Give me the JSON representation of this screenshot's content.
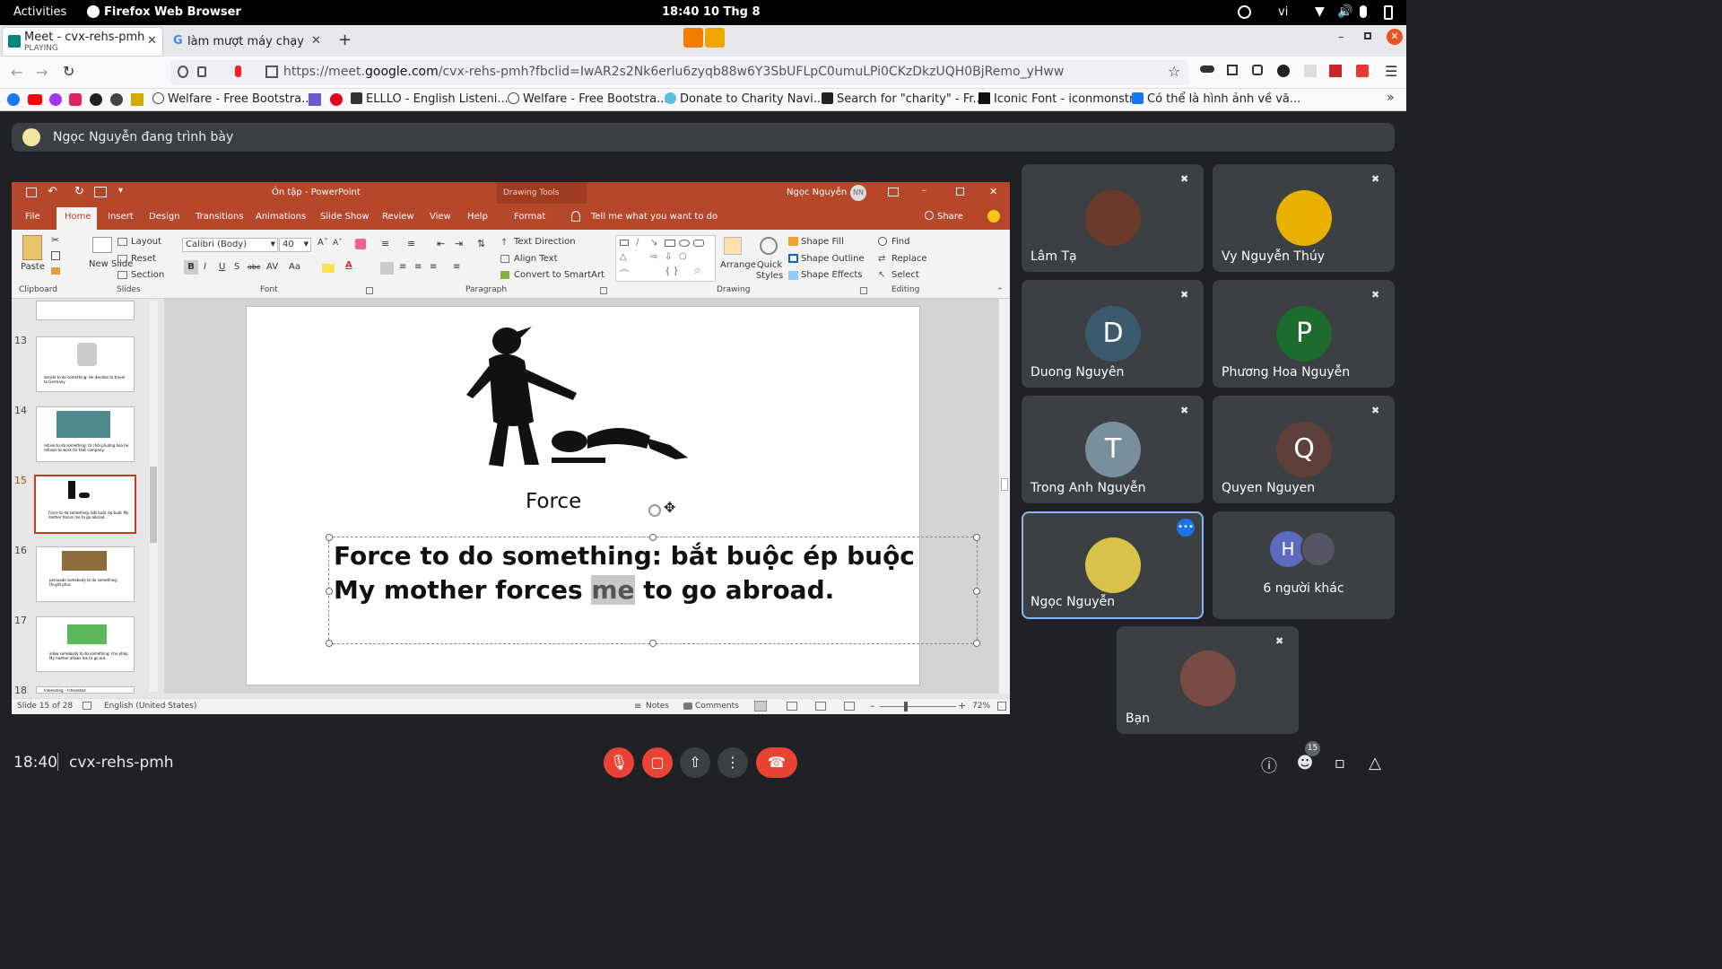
{
  "gnome": {
    "activities": "Activities",
    "app": "Firefox Web Browser",
    "clock": "18:40  10 Thg 8",
    "lang": "vi"
  },
  "tabs": [
    {
      "title": "Meet - cvx-rehs-pmh",
      "sub": "PLAYING"
    },
    {
      "title": "làm mượt máy chạy hệ"
    }
  ],
  "url": {
    "prefix": "https://meet.",
    "domain": "google.com",
    "rest": "/cvx-rehs-pmh?fbclid=IwAR2s2Nk6erlu6zyqb88w6Y3SbUFLpC0umuLPi0CKzDkzUQH0BjRemo_yHww"
  },
  "bookmarks": [
    "Welfare - Free Bootstra...",
    "ELLLO - English Listeni...",
    "Welfare - Free Bootstra...",
    "Donate to Charity Navi...",
    "Search for \"charity\" - Fr...",
    "Iconic Font - iconmonstr",
    "Có thể là hình ảnh về vă..."
  ],
  "presenting": "Ngọc Nguyễn đang trình bày",
  "ppt": {
    "title": "Ôn tập  -  PowerPoint",
    "drawing_tools": "Drawing Tools",
    "user": "Ngọc Nguyễn",
    "initials": "NN",
    "tabs": [
      "File",
      "Home",
      "Insert",
      "Design",
      "Transitions",
      "Animations",
      "Slide Show",
      "Review",
      "View",
      "Help",
      "Format"
    ],
    "tell_me": "Tell me what you want to do",
    "share": "Share",
    "groups": [
      "Clipboard",
      "Slides",
      "Font",
      "Paragraph",
      "Drawing",
      "Editing"
    ],
    "ribbon": {
      "paste": "Paste",
      "new_slide": "New Slide",
      "layout": "Layout",
      "reset": "Reset",
      "section": "Section",
      "font_name": "Calibri (Body)",
      "font_size": "40",
      "text_direction": "Text Direction",
      "align_text": "Align Text",
      "convert_smartart": "Convert to SmartArt",
      "arrange": "Arrange",
      "quick_styles": "Quick Styles",
      "shape_fill": "Shape Fill",
      "shape_outline": "Shape Outline",
      "shape_effects": "Shape Effects",
      "find": "Find",
      "replace": "Replace",
      "select": "Select"
    },
    "thumbs": [
      {
        "num": "13",
        "text": "decide to do something: He decides to travel to Germany"
      },
      {
        "num": "14",
        "text": "refuse to do something: từ chối phương hoa he refuses to work for that company."
      },
      {
        "num": "15",
        "text": "Force to do something: bắt buộc ép buộc My mother forces me to go abroad."
      },
      {
        "num": "16",
        "text": "persuade somebody to do something: thuyết phục"
      },
      {
        "num": "17",
        "text": "allow somebody to do something: cho phép My mother allows me to go out."
      },
      {
        "num": "18",
        "text": "Interesting – Interested"
      }
    ],
    "slide": {
      "caption": "Force",
      "line1": "Force to do something: bắt buộc ép buộc",
      "line2_a": "My mother forces ",
      "line2_hl": "me",
      "line2_b": " to go abroad."
    },
    "status": {
      "slide_of": "Slide 15 of 28",
      "language": "English (United States)",
      "notes": "Notes",
      "comments": "Comments",
      "zoom": "72%"
    }
  },
  "participants": [
    {
      "name": "Lâm Tạ",
      "kind": "photo",
      "color": "#6b3a2a"
    },
    {
      "name": "Vy Nguyễn Thúy",
      "kind": "photo",
      "color": "#e8b000"
    },
    {
      "name": "Duong Nguyên",
      "kind": "letter",
      "letter": "D",
      "color": "#3c5a6e"
    },
    {
      "name": "Phương Hoa Nguyễn",
      "kind": "letter",
      "letter": "P",
      "color": "#1e6b2e"
    },
    {
      "name": "Trong Anh Nguyễn",
      "kind": "letter",
      "letter": "T",
      "color": "#78909c"
    },
    {
      "name": "Quyen Nguyen",
      "kind": "letter",
      "letter": "Q",
      "color": "#5d4037"
    },
    {
      "name": "Ngọc Nguyễn",
      "kind": "photo",
      "color": "#d8c24a"
    },
    {
      "name": "Bạn",
      "kind": "photo",
      "color": "#7a4a45"
    }
  ],
  "others": {
    "letter": "H",
    "label": "6 người khác"
  },
  "bottom": {
    "time": "18:40",
    "code": "cvx-rehs-pmh",
    "people_count": "15"
  },
  "colors": {
    "meet_bg": "#202124",
    "tile_bg": "#3c4043",
    "ppt_accent": "#b7472a",
    "danger": "#ea4335",
    "active_border": "#8ab4f8"
  }
}
